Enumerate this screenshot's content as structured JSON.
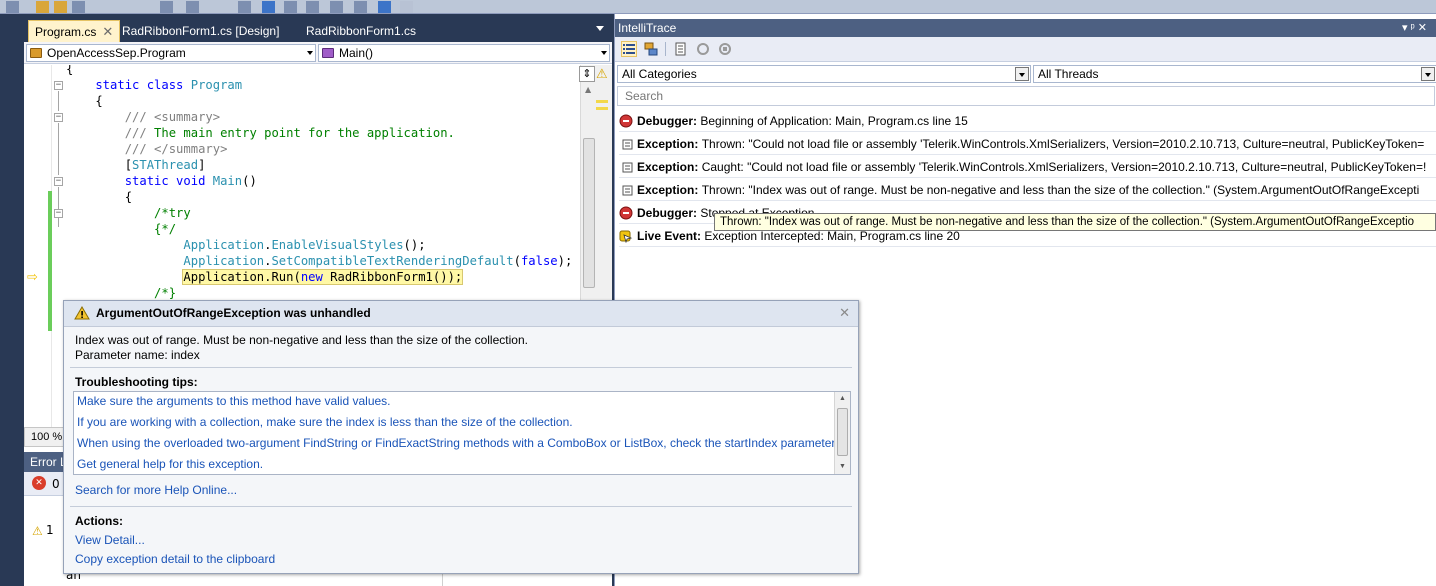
{
  "editor": {
    "tabs": [
      {
        "label": "Program.cs",
        "active": true
      },
      {
        "label": "RadRibbonForm1.cs [Design]",
        "active": false
      },
      {
        "label": "RadRibbonForm1.cs",
        "active": false
      }
    ],
    "close_glyph": "✕",
    "nav": {
      "type_combo": "OpenAccessSep.Program",
      "member_combo": "Main()"
    },
    "code_lines": [
      {
        "text": "{",
        "html": "{"
      },
      {
        "text": "    static class Program"
      },
      {
        "text": "    {"
      },
      {
        "text": "        /// <summary>"
      },
      {
        "text": "        /// The main entry point for the application."
      },
      {
        "text": "        /// </summary>"
      },
      {
        "text": "        [STAThread]"
      },
      {
        "text": "        static void Main()"
      },
      {
        "text": "        {"
      },
      {
        "text": "            /*try"
      },
      {
        "text": "            {*/"
      },
      {
        "text": "                Application.EnableVisualStyles();"
      },
      {
        "text": "                Application.SetCompatibleTextRenderingDefault(false);"
      },
      {
        "text": "                Application.Run(new RadRibbonForm1());"
      },
      {
        "text": "            /*}"
      }
    ],
    "zoom": "100 %"
  },
  "error_list": {
    "title": "Error L",
    "error_count": "0",
    "warning_count": "1",
    "partial_text": "an"
  },
  "intellitrace": {
    "title": "IntelliTrace",
    "pin_glyph": "▾ ᵖ ✕",
    "category_filter": "All Categories",
    "thread_filter": "All Threads",
    "search_placeholder": "Search",
    "events": [
      {
        "type": "Debugger",
        "icon": "debugger-icon",
        "text": "Beginning of Application: Main, Program.cs line 15"
      },
      {
        "type": "Exception",
        "icon": "exception-icon",
        "text": "Thrown: \"Could not load file or assembly 'Telerik.WinControls.XmlSerializers, Version=2010.2.10.713, Culture=neutral, PublicKeyToken="
      },
      {
        "type": "Exception",
        "icon": "exception-icon",
        "text": "Caught: \"Could not load file or assembly 'Telerik.WinControls.XmlSerializers, Version=2010.2.10.713, Culture=neutral, PublicKeyToken=!"
      },
      {
        "type": "Exception",
        "icon": "exception-icon",
        "text": "Thrown: \"Index was out of range. Must be non-negative and less than the size of the collection.\" (System.ArgumentOutOfRangeExcepti"
      },
      {
        "type": "Debugger",
        "icon": "debugger-icon",
        "text": "Stopped at Exception"
      },
      {
        "type": "Live Event",
        "icon": "live-event-icon",
        "text": "Exception Intercepted: Main, Program.cs line 20"
      }
    ],
    "tooltip": "Thrown: \"Index was out of range. Must be non-negative and less than the size of the collection.\" (System.ArgumentOutOfRangeExceptio"
  },
  "exception_popup": {
    "title": "ArgumentOutOfRangeException was unhandled",
    "close_glyph": "✕",
    "message_line1": "Index was out of range. Must be non-negative and less than the size of the collection.",
    "message_line2": "Parameter name: index",
    "tips_heading": "Troubleshooting tips:",
    "tips": [
      "Make sure the arguments to this method have valid values.",
      "If you are working with a collection, make sure the index is less than the size of the collection.",
      "When using the overloaded two-argument FindString or FindExactString methods with a ComboBox or ListBox, check the startIndex parameter.",
      "Get general help for this exception."
    ],
    "help_online": "Search for more Help Online...",
    "actions_heading": "Actions:",
    "view_detail": "View Detail...",
    "copy_detail": "Copy exception detail to the clipboard"
  },
  "colors": {
    "chrome": "#293955",
    "tool_window_title": "#4d6082",
    "link": "#1a54b8",
    "change_bar": "#6bcd5b",
    "current_statement": "#fff8a6"
  }
}
